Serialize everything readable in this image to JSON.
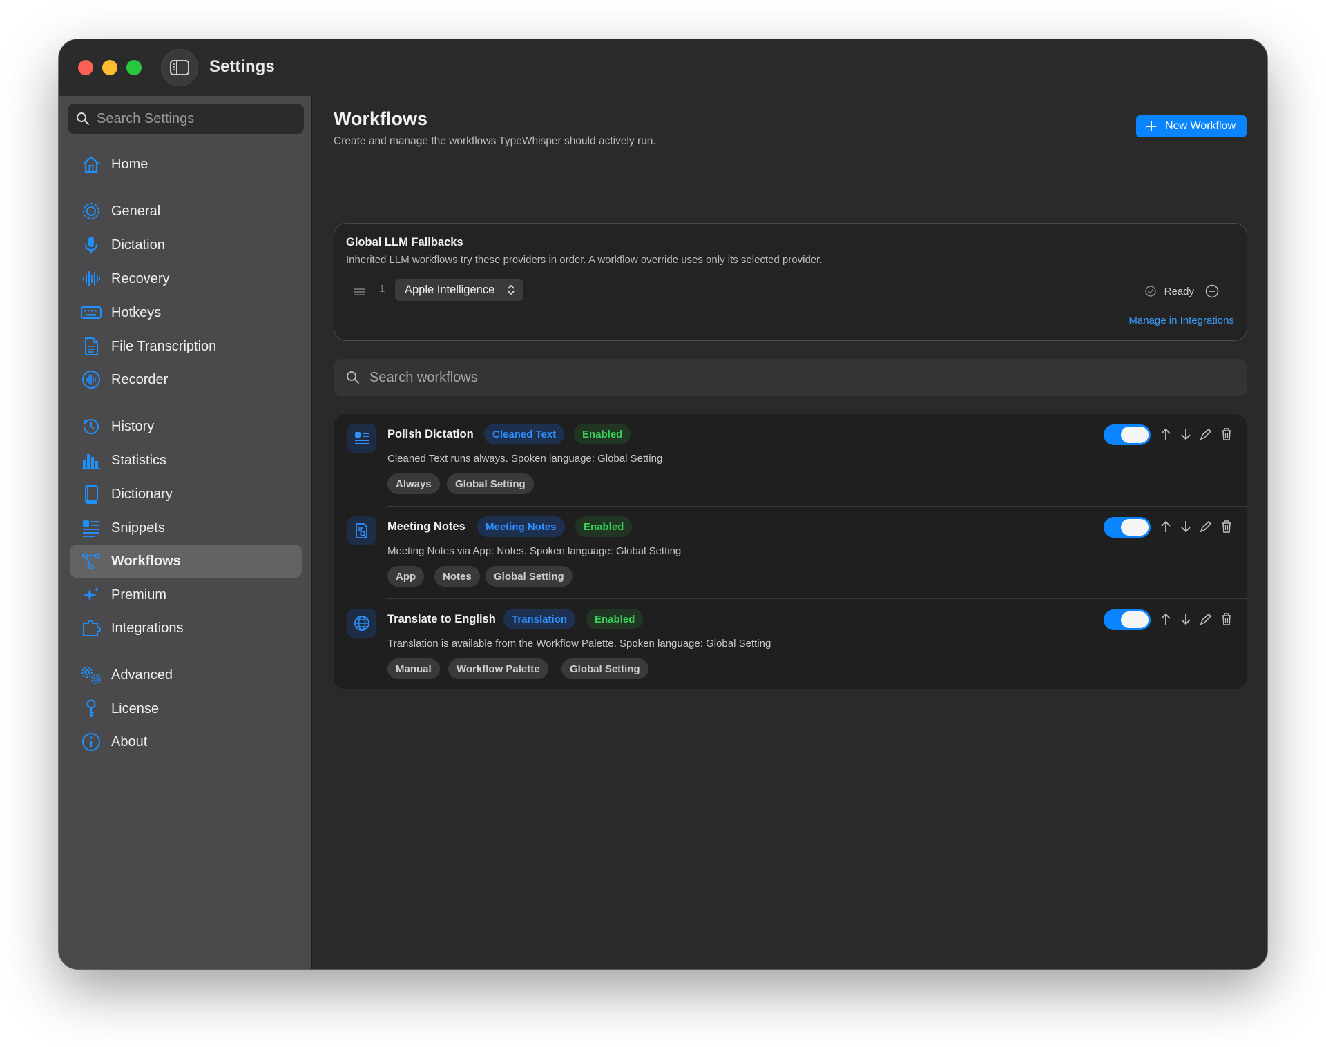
{
  "window": {
    "title": "Settings"
  },
  "sidebar": {
    "search_placeholder": "Search Settings",
    "items": [
      {
        "label": "Home",
        "icon": "house-icon"
      },
      {
        "label": "General",
        "icon": "gear-icon"
      },
      {
        "label": "Dictation",
        "icon": "microphone-icon"
      },
      {
        "label": "Recovery",
        "icon": "waveform-icon"
      },
      {
        "label": "Hotkeys",
        "icon": "keyboard-icon"
      },
      {
        "label": "File Transcription",
        "icon": "document-icon"
      },
      {
        "label": "Recorder",
        "icon": "record-waveform-icon"
      },
      {
        "label": "History",
        "icon": "history-clock-icon"
      },
      {
        "label": "Statistics",
        "icon": "bar-chart-icon"
      },
      {
        "label": "Dictionary",
        "icon": "book-icon"
      },
      {
        "label": "Snippets",
        "icon": "text-snippet-icon"
      },
      {
        "label": "Workflows",
        "icon": "flow-nodes-icon"
      },
      {
        "label": "Premium",
        "icon": "sparkles-icon"
      },
      {
        "label": "Integrations",
        "icon": "puzzle-icon"
      },
      {
        "label": "Advanced",
        "icon": "gears-icon"
      },
      {
        "label": "License",
        "icon": "key-icon"
      },
      {
        "label": "About",
        "icon": "info-icon"
      }
    ],
    "active": "Workflows"
  },
  "main": {
    "title": "Workflows",
    "subtitle": "Create and manage the workflows TypeWhisper should actively run.",
    "new_button": "New Workflow",
    "fallbacks": {
      "title": "Global LLM Fallbacks",
      "description": "Inherited LLM workflows try these providers in order. A workflow override uses only its selected provider.",
      "order": "1",
      "provider": "Apple Intelligence",
      "status": "Ready",
      "link": "Manage in Integrations"
    },
    "search_placeholder": "Search workflows",
    "workflows": [
      {
        "name": "Polish Dictation",
        "type": "Cleaned Text",
        "status": "Enabled",
        "description": "Cleaned Text runs always. Spoken language: Global Setting",
        "chips": [
          "Always",
          "Global Setting"
        ],
        "icon": "list-checklist-icon",
        "enabled": true
      },
      {
        "name": "Meeting Notes",
        "type": "Meeting Notes",
        "status": "Enabled",
        "description": "Meeting Notes via App: Notes. Spoken language: Global Setting",
        "chips": [
          "App",
          "Notes",
          "Global Setting"
        ],
        "icon": "document-search-icon",
        "enabled": true
      },
      {
        "name": "Translate to English",
        "type": "Translation",
        "status": "Enabled",
        "description": "Translation is available from the Workflow Palette. Spoken language: Global Setting",
        "chips": [
          "Manual",
          "Workflow Palette",
          "Global Setting"
        ],
        "icon": "globe-icon",
        "enabled": true
      }
    ]
  },
  "colors": {
    "accent": "#0a84ff",
    "enabled_text": "#37d158",
    "type_badge_text": "#2f90ff",
    "link": "#3b9eff"
  }
}
